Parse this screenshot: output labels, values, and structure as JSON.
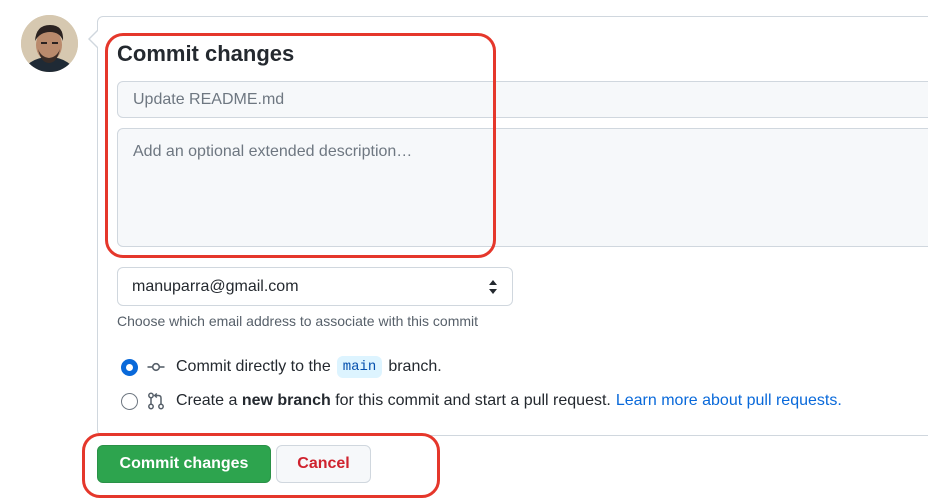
{
  "form": {
    "title": "Commit changes",
    "summary_placeholder": "Update README.md",
    "description_placeholder": "Add an optional extended description…",
    "email_selected": "manuparra@gmail.com",
    "email_hint": "Choose which email address to associate with this commit",
    "option_direct": {
      "prefix": "Commit directly to the",
      "branch": "main",
      "suffix": "branch.",
      "selected": true,
      "icon": "git-commit-icon"
    },
    "option_new_branch": {
      "prefix": "Create a",
      "bold": "new branch",
      "middle": "for this commit and start a pull request.",
      "link": "Learn more about pull requests.",
      "selected": false,
      "icon": "git-pull-request-icon"
    }
  },
  "buttons": {
    "commit": "Commit changes",
    "cancel": "Cancel"
  },
  "colors": {
    "commit_button": "#2da44e",
    "cancel_text": "#cf222e",
    "link": "#0969da",
    "highlight": "#e5372b"
  }
}
